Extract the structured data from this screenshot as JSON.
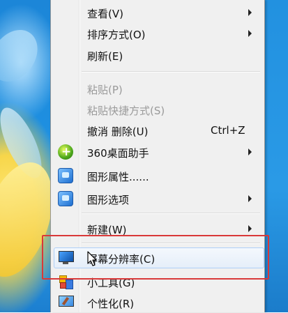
{
  "menu": {
    "items": [
      {
        "label": "查看(V)",
        "submenu": true,
        "enabled": true
      },
      {
        "label": "排序方式(O)",
        "submenu": true,
        "enabled": true
      },
      {
        "label": "刷新(E)",
        "submenu": false,
        "enabled": true
      },
      {
        "label": "粘贴(P)",
        "submenu": false,
        "enabled": false
      },
      {
        "label": "粘贴快捷方式(S)",
        "submenu": false,
        "enabled": false
      },
      {
        "label": "撤消 删除(U)",
        "shortcut": "Ctrl+Z",
        "submenu": false,
        "enabled": true
      },
      {
        "label": "360桌面助手",
        "icon": "360-icon",
        "submenu": true,
        "enabled": true
      },
      {
        "label": "图形属性......",
        "icon": "graphics-icon",
        "submenu": false,
        "enabled": true
      },
      {
        "label": "图形选项",
        "icon": "graphics-icon",
        "submenu": true,
        "enabled": true
      },
      {
        "label": "新建(W)",
        "submenu": true,
        "enabled": true
      },
      {
        "label": "屏幕分辨率(C)",
        "icon": "monitor-icon",
        "submenu": false,
        "enabled": true,
        "hovered": true
      },
      {
        "label": "小工具(G)",
        "icon": "gadgets-icon",
        "submenu": false,
        "enabled": true
      },
      {
        "label": "个性化(R)",
        "icon": "personalize-icon",
        "submenu": false,
        "enabled": true
      }
    ]
  },
  "colors": {
    "menu_bg": "#f0f0f0",
    "disabled_text": "#9a9a9a",
    "highlight_border": "#aecff7",
    "annotation_red": "#d93838",
    "desktop_blue": "#1e8fe0"
  }
}
